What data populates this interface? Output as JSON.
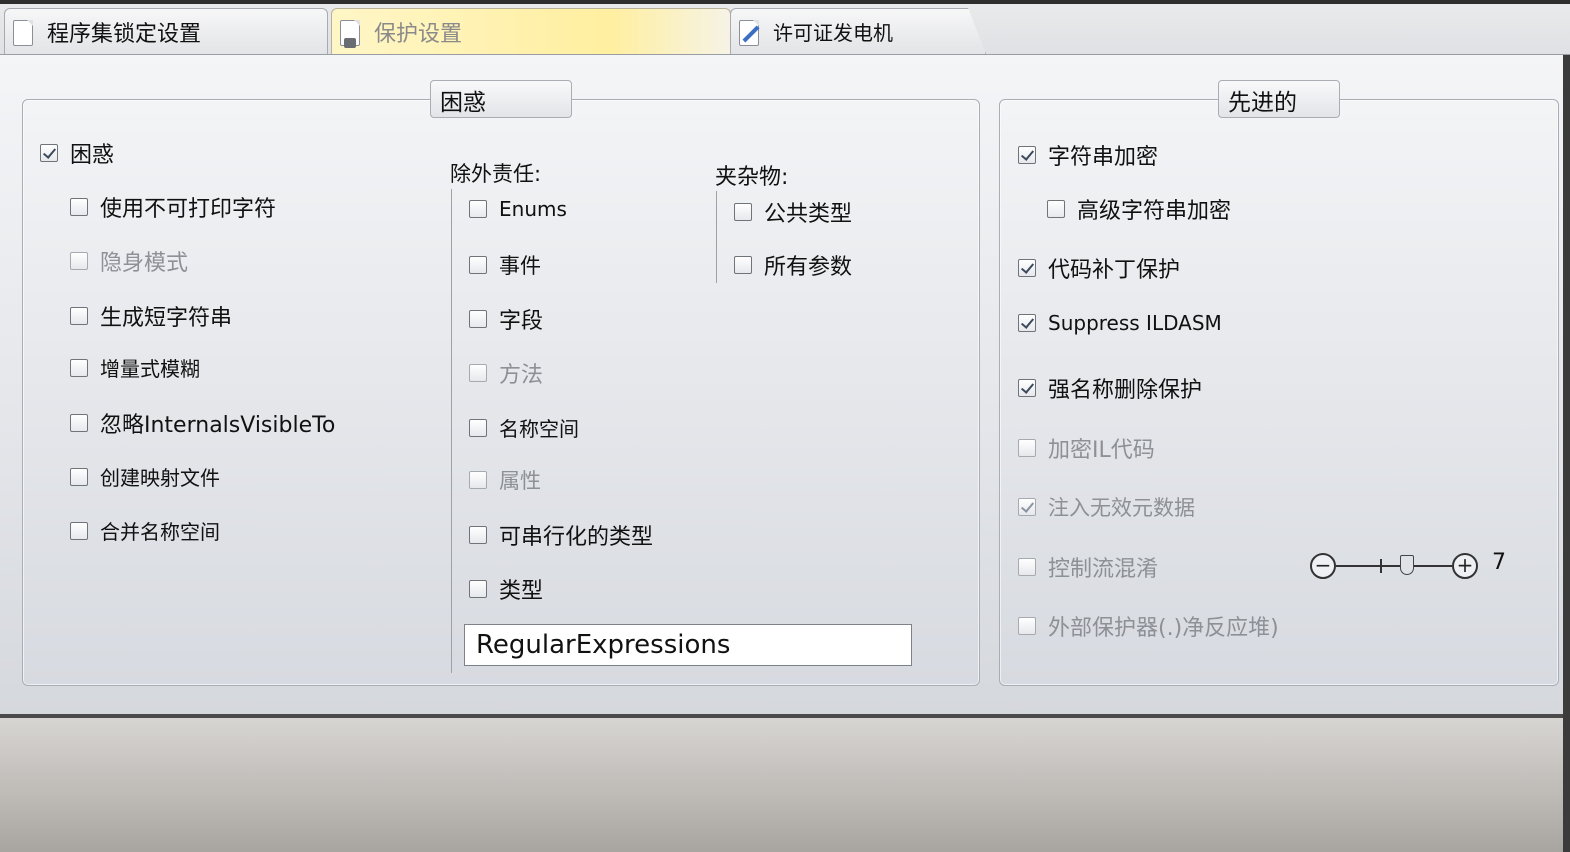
{
  "tabs": [
    {
      "label": "程序集锁定设置",
      "icon": "lock-document-icon"
    },
    {
      "label": "保护设置",
      "icon": "lock-document-icon",
      "active": true
    },
    {
      "label": "许可证发电机",
      "icon": "license-key-icon"
    }
  ],
  "obfuscation_group": {
    "title": "困惑",
    "main_option": {
      "label": "困惑",
      "checked": true
    },
    "options": [
      {
        "label": "使用不可打印字符",
        "checked": false,
        "enabled": true
      },
      {
        "label": "隐身模式",
        "checked": false,
        "enabled": false
      },
      {
        "label": "生成短字符串",
        "checked": false,
        "enabled": true
      },
      {
        "label": "增量式模糊",
        "checked": false,
        "enabled": true
      },
      {
        "label": "忽略InternalsVisibleTo",
        "checked": false,
        "enabled": true
      },
      {
        "label": "创建映射文件",
        "checked": false,
        "enabled": true
      },
      {
        "label": "合并名称空间",
        "checked": false,
        "enabled": true
      }
    ],
    "exclusions": {
      "title": "除外责任:",
      "items": [
        {
          "label": "Enums",
          "checked": false,
          "enabled": true
        },
        {
          "label": "事件",
          "checked": false,
          "enabled": true
        },
        {
          "label": "字段",
          "checked": false,
          "enabled": true
        },
        {
          "label": "方法",
          "checked": false,
          "enabled": false
        },
        {
          "label": "名称空间",
          "checked": false,
          "enabled": true
        },
        {
          "label": "属性",
          "checked": false,
          "enabled": false
        },
        {
          "label": "可串行化的类型",
          "checked": false,
          "enabled": true
        },
        {
          "label": "类型",
          "checked": false,
          "enabled": true
        }
      ],
      "namespace_filter_value": "RegularExpressions"
    },
    "misc": {
      "title": "夹杂物:",
      "items": [
        {
          "label": "公共类型",
          "checked": false,
          "enabled": true
        },
        {
          "label": "所有参数",
          "checked": false,
          "enabled": true
        }
      ]
    }
  },
  "advanced_group": {
    "title": "先进的",
    "options": [
      {
        "label": "字符串加密",
        "checked": true,
        "enabled": true
      },
      {
        "label": "高级字符串加密",
        "checked": false,
        "enabled": true
      },
      {
        "label": "代码补丁保护",
        "checked": true,
        "enabled": true
      },
      {
        "label": "Suppress ILDASM",
        "checked": true,
        "enabled": true
      },
      {
        "label": "强名称删除保护",
        "checked": true,
        "enabled": true
      },
      {
        "label": "加密IL代码",
        "checked": false,
        "enabled": false
      },
      {
        "label": "注入无效元数据",
        "checked": true,
        "enabled": false
      },
      {
        "label": "控制流混淆",
        "checked": false,
        "enabled": false
      },
      {
        "label": "外部保护器(.)净反应堆)",
        "checked": false,
        "enabled": false
      }
    ],
    "control_flow_level": "7",
    "slider_minus": "−",
    "slider_plus": "+"
  }
}
